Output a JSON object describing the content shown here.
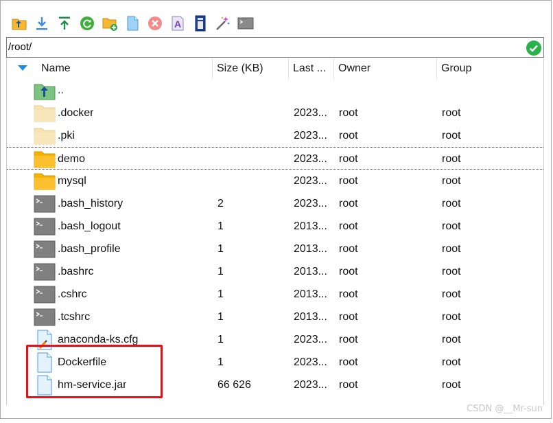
{
  "toolbar": {
    "buttons": [
      {
        "name": "parent-folder-button",
        "icon": "folder-up-icon"
      },
      {
        "name": "download-button",
        "icon": "download-icon"
      },
      {
        "name": "upload-button",
        "icon": "upload-icon"
      },
      {
        "name": "refresh-button",
        "icon": "refresh-icon"
      },
      {
        "name": "new-folder-button",
        "icon": "new-folder-icon"
      },
      {
        "name": "new-file-button",
        "icon": "new-file-icon"
      },
      {
        "name": "delete-button",
        "icon": "delete-icon"
      },
      {
        "name": "rename-button",
        "icon": "rename-icon"
      },
      {
        "name": "properties-button",
        "icon": "properties-icon"
      },
      {
        "name": "magic-button",
        "icon": "magic-wand-icon"
      },
      {
        "name": "terminal-button",
        "icon": "terminal-icon"
      }
    ]
  },
  "path": {
    "value": "/root/"
  },
  "columns": {
    "name": "Name",
    "size": "Size (KB)",
    "last": "Last ...",
    "owner": "Owner",
    "group": "Group"
  },
  "files": [
    {
      "name": "..",
      "size": "",
      "last": "",
      "owner": "",
      "group": "",
      "type": "parent"
    },
    {
      "name": ".docker",
      "size": "",
      "last": "2023...",
      "owner": "root",
      "group": "root",
      "type": "folder-light"
    },
    {
      "name": ".pki",
      "size": "",
      "last": "2023...",
      "owner": "root",
      "group": "root",
      "type": "folder-light"
    },
    {
      "name": "demo",
      "size": "",
      "last": "2023...",
      "owner": "root",
      "group": "root",
      "type": "folder"
    },
    {
      "name": "mysql",
      "size": "",
      "last": "2023...",
      "owner": "root",
      "group": "root",
      "type": "folder"
    },
    {
      "name": ".bash_history",
      "size": "2",
      "last": "2023...",
      "owner": "root",
      "group": "root",
      "type": "shell"
    },
    {
      "name": ".bash_logout",
      "size": "1",
      "last": "2013...",
      "owner": "root",
      "group": "root",
      "type": "shell"
    },
    {
      "name": ".bash_profile",
      "size": "1",
      "last": "2013...",
      "owner": "root",
      "group": "root",
      "type": "shell"
    },
    {
      "name": ".bashrc",
      "size": "1",
      "last": "2013...",
      "owner": "root",
      "group": "root",
      "type": "shell"
    },
    {
      "name": ".cshrc",
      "size": "1",
      "last": "2013...",
      "owner": "root",
      "group": "root",
      "type": "shell"
    },
    {
      "name": ".tcshrc",
      "size": "1",
      "last": "2013...",
      "owner": "root",
      "group": "root",
      "type": "shell"
    },
    {
      "name": "anaconda-ks.cfg",
      "size": "1",
      "last": "2023...",
      "owner": "root",
      "group": "root",
      "type": "config"
    },
    {
      "name": "Dockerfile",
      "size": "1",
      "last": "2023...",
      "owner": "root",
      "group": "root",
      "type": "file"
    },
    {
      "name": "hm-service.jar",
      "size": "66 626",
      "last": "2023...",
      "owner": "root",
      "group": "root",
      "type": "file"
    }
  ],
  "selected_row": 3,
  "watermark": "CSDN @__Mr-sun",
  "colors": {
    "accent": "#1b8ce6",
    "highlight_box": "#e2121b",
    "folder": "#fbc02d",
    "folder_light": "#f7e3b1",
    "ok": "#27b34a"
  }
}
